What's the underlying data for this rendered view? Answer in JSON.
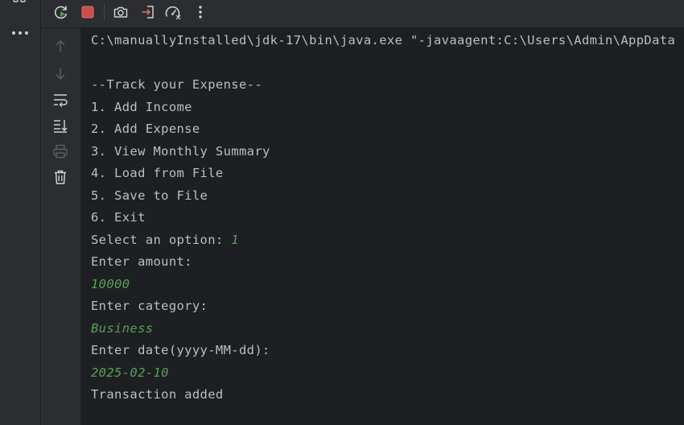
{
  "toolbar": {
    "buttons": [
      {
        "name": "rerun",
        "icon": "rerun-icon"
      },
      {
        "name": "stop",
        "icon": "stop-icon"
      },
      {
        "name": "screenshot",
        "icon": "camera-icon"
      },
      {
        "name": "exit",
        "icon": "exit-icon"
      },
      {
        "name": "profiler",
        "icon": "gauge-icon"
      },
      {
        "name": "more",
        "icon": "kebab-menu-icon"
      }
    ]
  },
  "gutter": {
    "buttons": [
      {
        "name": "scroll-up",
        "icon": "arrow-up-icon"
      },
      {
        "name": "scroll-down",
        "icon": "arrow-down-icon"
      },
      {
        "name": "soft-wrap",
        "icon": "soft-wrap-icon"
      },
      {
        "name": "scroll-to-end",
        "icon": "scroll-to-end-icon"
      },
      {
        "name": "print",
        "icon": "printer-icon"
      },
      {
        "name": "clear",
        "icon": "trash-icon"
      }
    ]
  },
  "console": {
    "command": "C:\\manuallyInstalled\\jdk-17\\bin\\java.exe \"-javaagent:C:\\Users\\Admin\\AppData",
    "menu_title": "--Track your Expense--",
    "menu_items": [
      "1. Add Income",
      "2. Add Expense",
      "3. View Monthly Summary",
      "4. Load from File",
      "5. Save to File",
      "6. Exit"
    ],
    "prompt_option": "Select an option: ",
    "input_option": "1",
    "prompt_amount": "Enter amount:",
    "input_amount": "10000",
    "prompt_category": "Enter category:",
    "input_category": "Business",
    "prompt_date": "Enter date(yyyy-MM-dd):",
    "input_date": "2025-02-10",
    "result": "Transaction added"
  },
  "colors": {
    "console_bg": "#1e1f22",
    "panel_bg": "#2b2d30",
    "text": "#bcbec4",
    "user_input": "#57a05a",
    "stop_red": "#c94f4f"
  }
}
